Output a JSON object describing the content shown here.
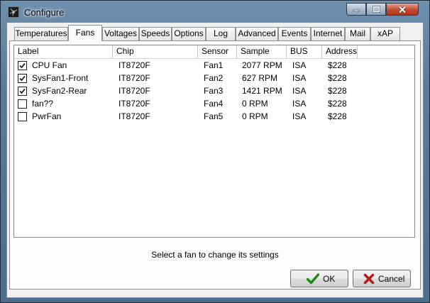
{
  "window": {
    "title": "Configure",
    "icon": "speedfan-icon"
  },
  "tabs": [
    {
      "label": "Temperatures",
      "active": false
    },
    {
      "label": "Fans",
      "active": true
    },
    {
      "label": "Voltages",
      "active": false
    },
    {
      "label": "Speeds",
      "active": false
    },
    {
      "label": "Options",
      "active": false
    },
    {
      "label": "Log",
      "active": false
    },
    {
      "label": "Advanced",
      "active": false
    },
    {
      "label": "Events",
      "active": false
    },
    {
      "label": "Internet",
      "active": false
    },
    {
      "label": "Mail",
      "active": false
    },
    {
      "label": "xAP",
      "active": false
    }
  ],
  "table": {
    "columns": [
      "Label",
      "Chip",
      "Sensor",
      "Sample",
      "BUS",
      "Address"
    ],
    "rows": [
      {
        "checked": true,
        "label": "CPU Fan",
        "chip": "IT8720F",
        "sensor": "Fan1",
        "sample": "2077 RPM",
        "bus": "ISA",
        "address": "$228"
      },
      {
        "checked": true,
        "label": "SysFan1-Front",
        "chip": "IT8720F",
        "sensor": "Fan2",
        "sample": "627 RPM",
        "bus": "ISA",
        "address": "$228"
      },
      {
        "checked": true,
        "label": "SysFan2-Rear",
        "chip": "IT8720F",
        "sensor": "Fan3",
        "sample": "1421 RPM",
        "bus": "ISA",
        "address": "$228"
      },
      {
        "checked": false,
        "label": "fan??",
        "chip": "IT8720F",
        "sensor": "Fan4",
        "sample": "0 RPM",
        "bus": "ISA",
        "address": "$228"
      },
      {
        "checked": false,
        "label": "PwrFan",
        "chip": "IT8720F",
        "sensor": "Fan5",
        "sample": "0 RPM",
        "bus": "ISA",
        "address": "$228"
      }
    ]
  },
  "status_text": "Select a fan to change its settings",
  "buttons": {
    "ok": "OK",
    "cancel": "Cancel"
  },
  "colors": {
    "ok_check": "#1e8a1e",
    "cancel_x": "#b01e1e"
  }
}
